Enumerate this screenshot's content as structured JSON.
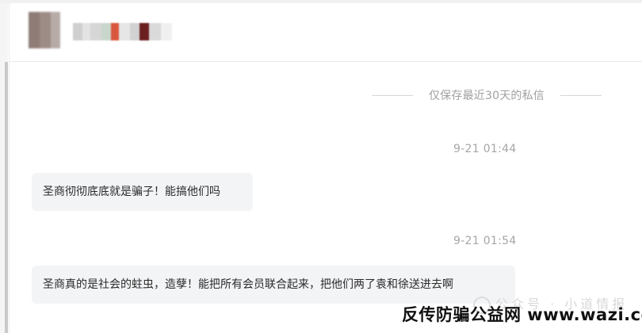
{
  "notice": "仅保存最近30天的私信",
  "messages": [
    {
      "time": "9-21 01:44",
      "text": "圣商彻彻底底就是骗子！能搞他们吗"
    },
    {
      "time": "9-21 01:54",
      "text": "圣商真的是社会的蛀虫，造孽！能把所有会员联合起来，把他们两了袁和徐送进去啊"
    }
  ],
  "watermark": "反传防骗公益网 www.wazi.cc",
  "colors": {
    "bubble_bg": "#f3f4f6",
    "muted_text": "#a0a0a0",
    "divider": "#ebebeb"
  }
}
